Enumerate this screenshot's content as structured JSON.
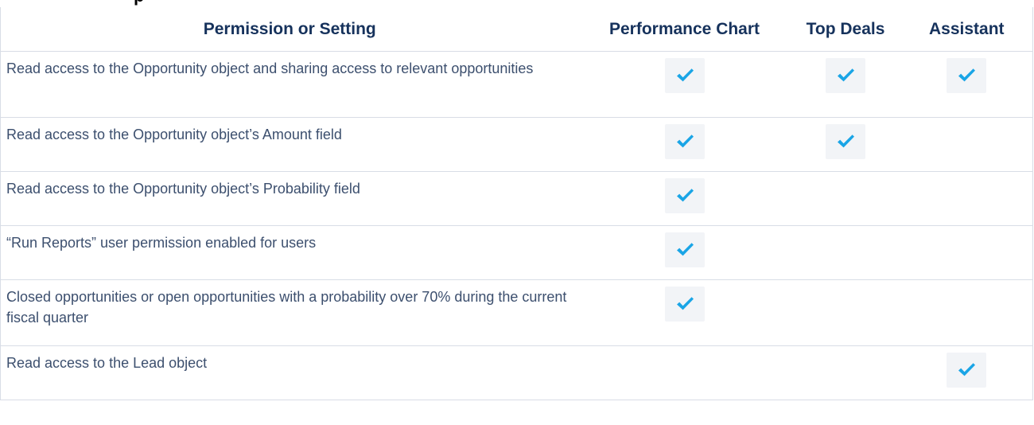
{
  "columns": [
    "Permission or Setting",
    "Performance Chart",
    "Top Deals",
    "Assistant"
  ],
  "rows": [
    {
      "label": "Read access to the Opportunity object and sharing access to relevant opportunities",
      "performance_chart": true,
      "top_deals": true,
      "assistant": true
    },
    {
      "label": "Read access to the Opportunity object’s Amount field",
      "performance_chart": true,
      "top_deals": true,
      "assistant": false
    },
    {
      "label": "Read access to the Opportunity object’s Probability field",
      "performance_chart": true,
      "top_deals": false,
      "assistant": false
    },
    {
      "label": "“Run Reports” user permission enabled for users",
      "performance_chart": true,
      "top_deals": false,
      "assistant": false
    },
    {
      "label": "Closed opportunities or open opportunities with a probability over 70% during the current fiscal quarter",
      "performance_chart": true,
      "top_deals": false,
      "assistant": false
    },
    {
      "label": "Read access to the Lead object",
      "performance_chart": false,
      "top_deals": false,
      "assistant": true
    }
  ],
  "colors": {
    "header_text": "#16325c",
    "body_text": "#3c4f6e",
    "border": "#d8dde6",
    "check": "#1aa5e6",
    "check_bg": "#f2f4f7"
  },
  "icons": {
    "check": "checkmark-icon"
  }
}
